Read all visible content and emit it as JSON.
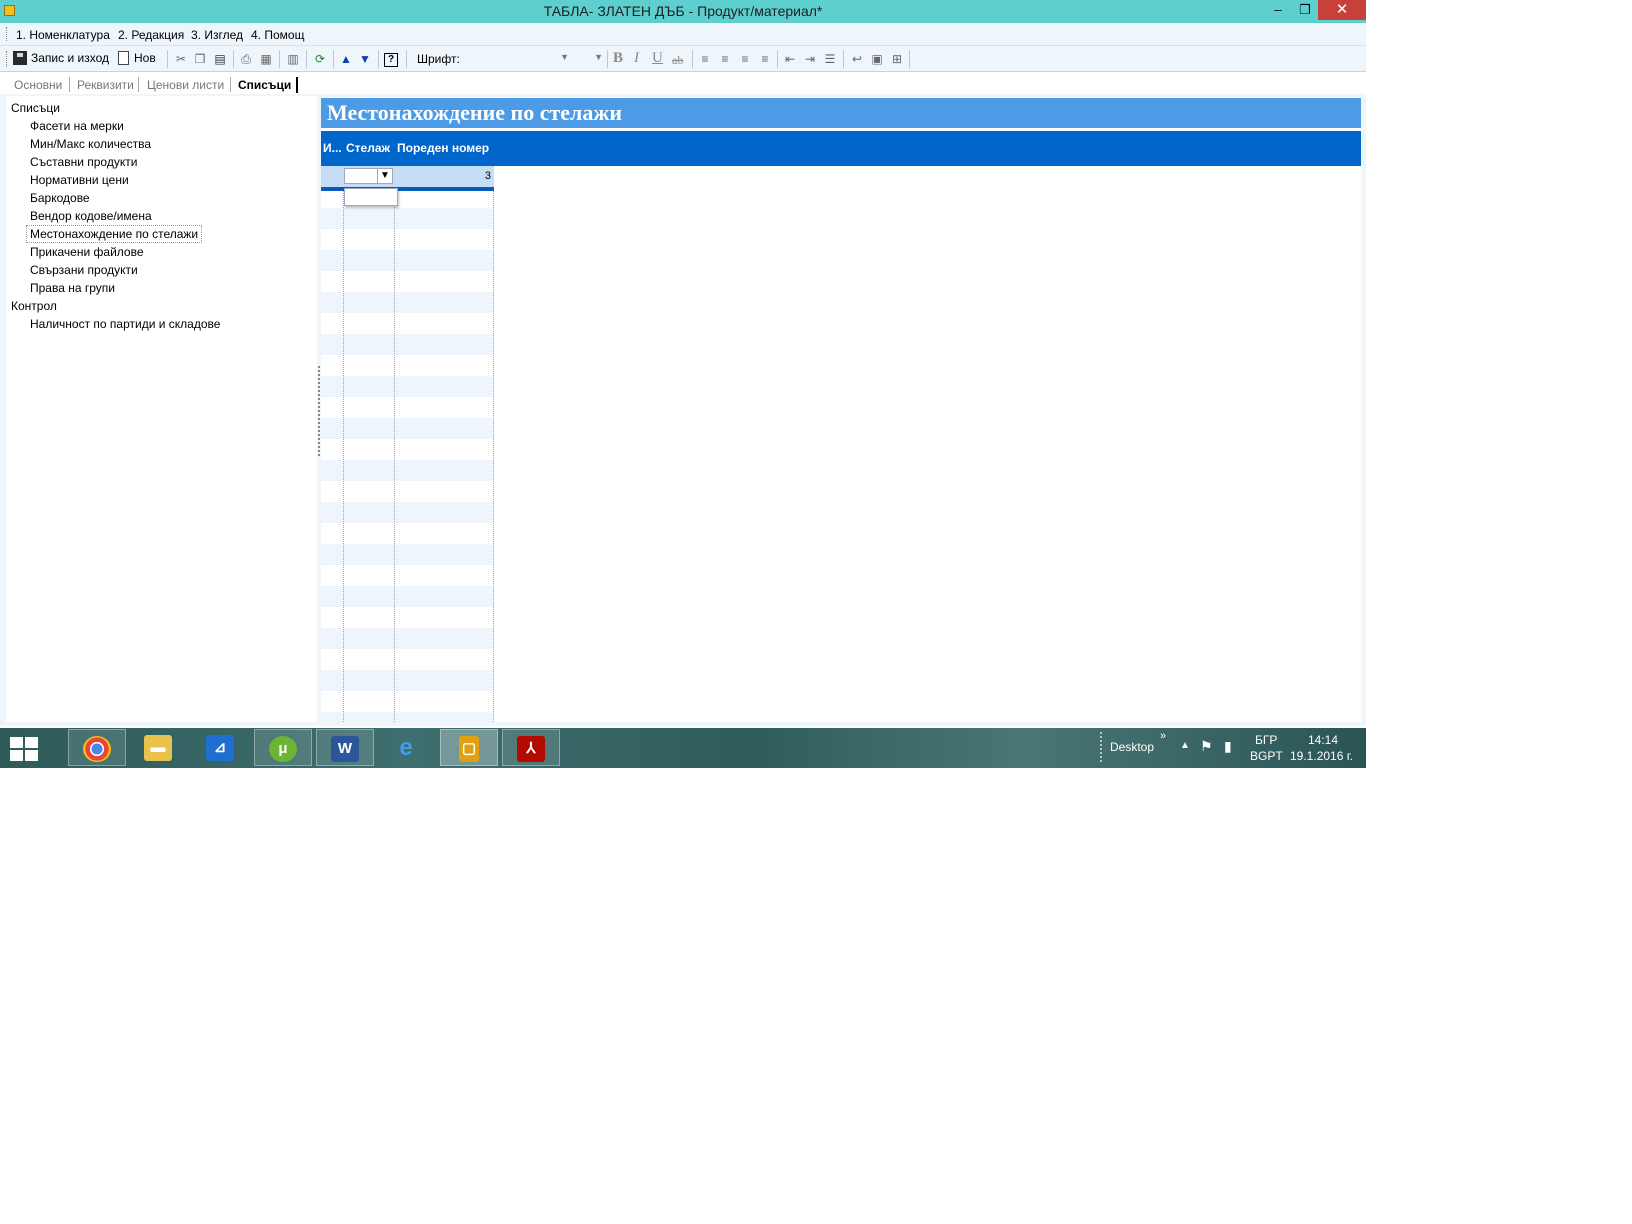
{
  "window": {
    "title": "ТАБЛА- ЗЛАТЕН ДЪБ - Продукт/материал*",
    "minimize": "‒",
    "maximize": "❐",
    "close": "✕"
  },
  "menu": [
    "1. Номенклатура",
    "2. Редакция",
    "3. Изглед",
    "4. Помощ"
  ],
  "toolbar": {
    "save_label": "Запис и изход",
    "new_label": "Нов",
    "font_label": "Шрифт:",
    "font_value": "",
    "size_value": ""
  },
  "tabs": [
    "Основни",
    "Реквизити",
    "Ценови листи",
    "Списъци"
  ],
  "active_tab": "Списъци",
  "tree": {
    "group1": "Списъци",
    "items1": [
      "Фасети на мерки",
      "Мин/Макс количества",
      "Съставни продукти",
      "Нормативни цени",
      "Баркодове",
      "Вендор кодове/имена",
      "Местонахождение по стелажи",
      "Прикачени файлове",
      "Свързани продукти",
      "Права на групи"
    ],
    "group2": "Контрол",
    "items2": [
      "Наличност по партиди и складове"
    ],
    "selected": "Местонахождение по стелажи"
  },
  "panel": {
    "title": "Местонахождение по стелажи",
    "columns": [
      "И...",
      "Стелаж",
      "Пореден номер"
    ],
    "current_row": {
      "id": "",
      "shelf": "",
      "seq": "3"
    }
  },
  "taskbar": {
    "apps": [
      "chrome-icon",
      "file-explorer-icon",
      "app-blue-icon",
      "utorrent-icon",
      "word-icon",
      "internet-explorer-icon",
      "app-yellow-icon",
      "acrobat-icon"
    ],
    "desktop_label": "Desktop",
    "chevron": "»",
    "lang_top": "БГР",
    "lang_bottom": "BGPT",
    "time": "14:14",
    "date": "19.1.2016 г."
  },
  "colors": {
    "titlebar": "#5ecfcf",
    "panel_header": "#4d9be6",
    "grid_header": "#0066cc",
    "close_button": "#c8403a"
  }
}
